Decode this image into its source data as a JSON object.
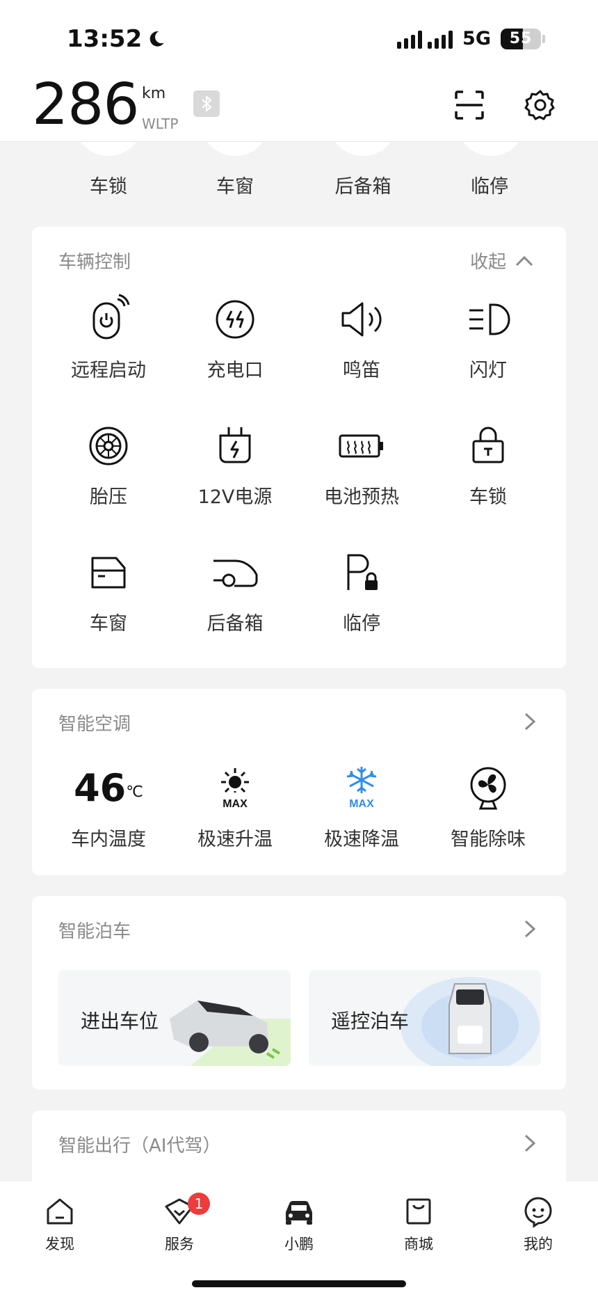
{
  "status_bar": {
    "time": "13:52",
    "network": "5G",
    "battery": "55",
    "battery_level": 0.55
  },
  "header": {
    "range_value": "286",
    "range_unit": "km",
    "range_standard": "WLTP"
  },
  "quick_controls": [
    {
      "label": "车锁"
    },
    {
      "label": "车窗"
    },
    {
      "label": "后备箱"
    },
    {
      "label": "临停"
    }
  ],
  "vehicle_control": {
    "title": "车辆控制",
    "collapse_label": "收起",
    "items": [
      {
        "label": "远程启动",
        "icon": "remote-start-icon"
      },
      {
        "label": "充电口",
        "icon": "charge-port-icon"
      },
      {
        "label": "鸣笛",
        "icon": "horn-icon"
      },
      {
        "label": "闪灯",
        "icon": "flash-lights-icon"
      },
      {
        "label": "胎压",
        "icon": "tire-pressure-icon"
      },
      {
        "label": "12V电源",
        "icon": "12v-power-icon"
      },
      {
        "label": "电池预热",
        "icon": "battery-preheat-icon"
      },
      {
        "label": "车锁",
        "icon": "lock-icon"
      },
      {
        "label": "车窗",
        "icon": "window-icon"
      },
      {
        "label": "后备箱",
        "icon": "trunk-icon"
      },
      {
        "label": "临停",
        "icon": "temp-parking-icon"
      }
    ]
  },
  "smart_ac": {
    "title": "智能空调",
    "cabin_temp": "46",
    "temp_unit": "℃",
    "items": [
      {
        "label": "车内温度"
      },
      {
        "label": "极速升温",
        "icon_text": "MAX"
      },
      {
        "label": "极速降温",
        "icon_text": "MAX"
      },
      {
        "label": "智能除味"
      }
    ]
  },
  "smart_parking": {
    "title": "智能泊车",
    "tiles": [
      {
        "label": "进出车位"
      },
      {
        "label": "遥控泊车"
      }
    ]
  },
  "smart_travel": {
    "title": "智能出行（AI代驾）"
  },
  "tabbar": {
    "items": [
      {
        "label": "发现"
      },
      {
        "label": "服务",
        "badge": "1"
      },
      {
        "label": "小鹏"
      },
      {
        "label": "商城"
      },
      {
        "label": "我的"
      }
    ]
  },
  "colors": {
    "accent_blue": "#2f8ee8",
    "badge_red": "#ee3b3b",
    "page_bg": "#f3f3f3"
  }
}
